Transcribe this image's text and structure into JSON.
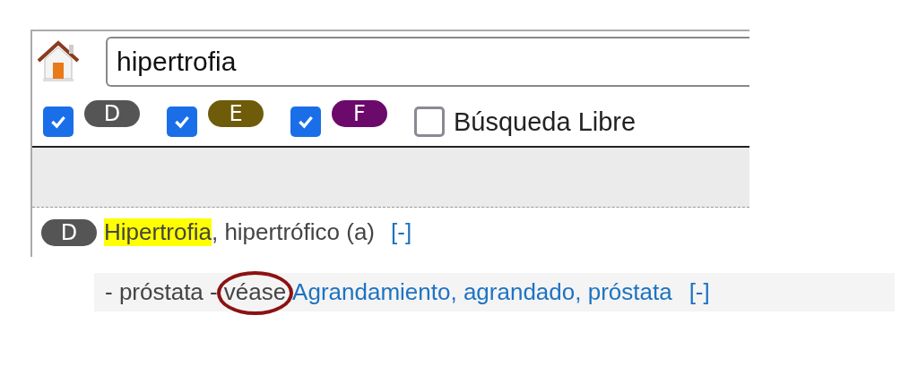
{
  "search": {
    "value": "hipertrofia"
  },
  "filters": [
    {
      "kind": "badge",
      "label": "D",
      "color": "#555555",
      "checked": true
    },
    {
      "kind": "badge",
      "label": "E",
      "color": "#6e5c0a",
      "checked": true
    },
    {
      "kind": "badge",
      "label": "F",
      "color": "#6b0a6b",
      "checked": true
    },
    {
      "kind": "text",
      "label": "Búsqueda Libre",
      "checked": false
    }
  ],
  "entry": {
    "badge": {
      "label": "D",
      "color": "#555555"
    },
    "term": "Hipertrofia",
    "highlighted": true,
    "rest": ", hipertrófico (a)",
    "toggle": "[-]"
  },
  "subentry": {
    "text": "- próstata -",
    "see": "véase",
    "circled": true,
    "link": "Agrandamiento, agrandado, próstata",
    "toggle": "[-]"
  }
}
